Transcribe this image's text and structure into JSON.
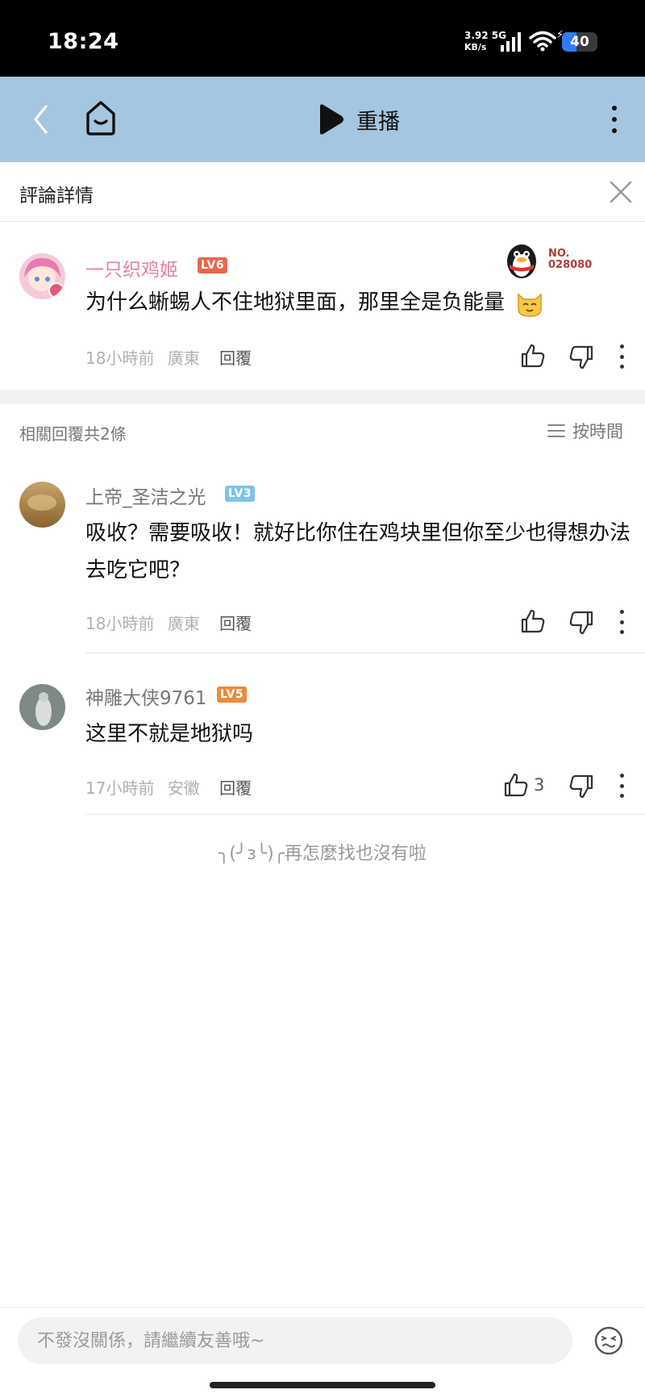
{
  "status_bar": {
    "time": "18:24",
    "net_speed": "3.92",
    "net_unit": "KB/s",
    "net_type": "5G",
    "battery": "40",
    "battery_level": 40
  },
  "header": {
    "replay_label": "重播",
    "icons": [
      "back-icon",
      "home-icon",
      "play-icon",
      "more-icon"
    ]
  },
  "detail": {
    "title": "評論詳情"
  },
  "main_comment": {
    "username": "一只织鸡姬",
    "level": "LV6",
    "badge_no": "NO.",
    "badge_number": "028080",
    "text": "为什么蜥蜴人不住地狱里面，那里全是负能量",
    "time": "18小時前",
    "location": "廣東",
    "reply_label": "回覆"
  },
  "replies_header": {
    "count_label": "相關回覆共2條",
    "sort_label": "按時間"
  },
  "replies": [
    {
      "username": "上帝_圣洁之光",
      "level": "LV3",
      "text": "吸收？需要吸收！就好比你住在鸡块里但你至少也得想办法去吃它吧？",
      "time": "18小時前",
      "location": "廣東",
      "reply_label": "回覆"
    },
    {
      "username": "神雕大侠9761",
      "level": "LV5",
      "text": "这里不就是地狱吗",
      "time": "17小時前",
      "location": "安徽",
      "reply_label": "回覆",
      "likes": "3"
    }
  ],
  "end_text": "╮(╯з╰)╭再怎麼找也沒有啦",
  "bottom_bar": {
    "input_placeholder": "不發沒關係，請繼續友善哦~"
  },
  "colors": {
    "header_bg": "#a5c6e0",
    "main_name": "#e87fa5",
    "lv6": "#e8664a",
    "lv3": "#7fc3e8",
    "lv5": "#ef8a3c",
    "reply_name": "#777777"
  }
}
